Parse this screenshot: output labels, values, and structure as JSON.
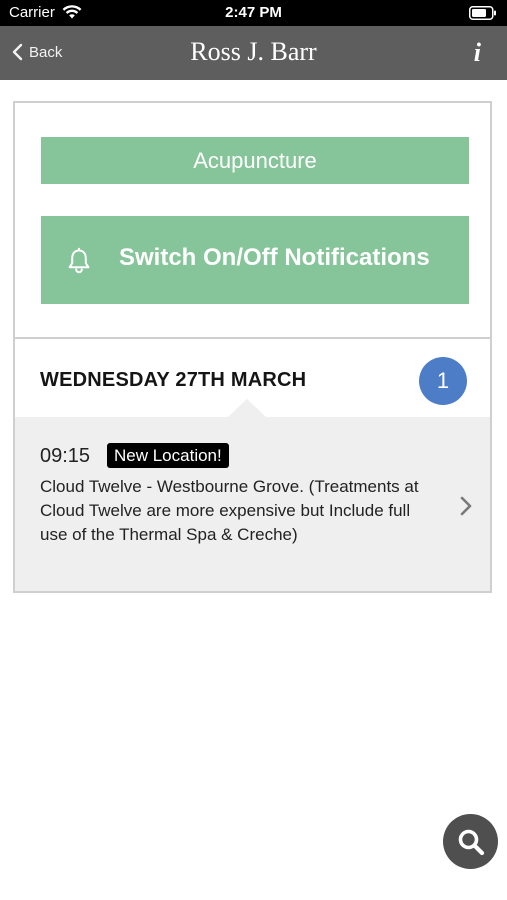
{
  "status_bar": {
    "carrier": "Carrier",
    "time": "2:47 PM"
  },
  "nav": {
    "back_label": "Back",
    "title": "Ross J. Barr",
    "info_label": "i"
  },
  "actions": {
    "service_label": "Acupuncture",
    "notifications_label": "Switch On/Off Notifications"
  },
  "schedule": {
    "day_label": "WEDNESDAY 27TH MARCH",
    "count": "1",
    "events": [
      {
        "time": "09:15",
        "badge": "New Location!",
        "description": "Cloud Twelve - Westbourne Grove. (Treatments at Cloud Twelve are more expensive but Include full use of the Thermal Spa & Creche)"
      }
    ]
  },
  "colors": {
    "nav_bar": "#5e5e5e",
    "accent_green": "#86c49a",
    "badge_blue": "#4e7dc8",
    "event_bg": "#efefef"
  },
  "icons": {
    "wifi": "wifi-icon",
    "battery": "battery-icon",
    "back": "chevron-left-icon",
    "bell": "bell-icon",
    "chevron": "chevron-right-icon",
    "search": "search-icon"
  }
}
